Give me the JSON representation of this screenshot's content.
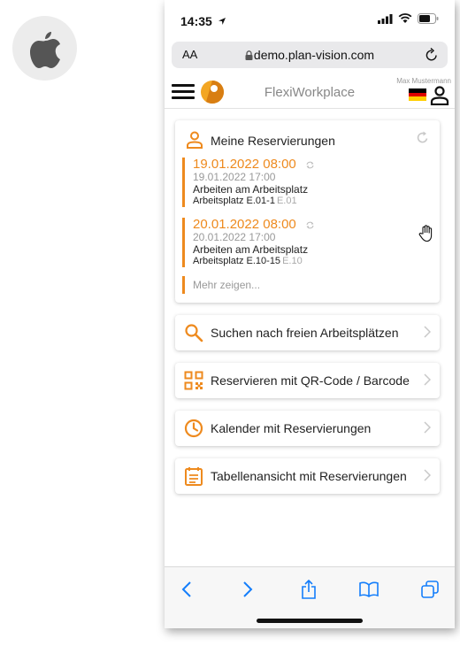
{
  "colors": {
    "accent": "#ee8a1e",
    "ios_blue": "#147efb"
  },
  "status_bar": {
    "time": "14:35"
  },
  "url_bar": {
    "aa_label": "AA",
    "url": "demo.plan-vision.com"
  },
  "app_header": {
    "title": "FlexiWorkplace",
    "user_name": "Max Mustermann"
  },
  "reservations": {
    "title": "Meine Reservierungen",
    "items": [
      {
        "start": "19.01.2022 08:00",
        "end": "19.01.2022 17:00",
        "description": "Arbeiten am Arbeitsplatz",
        "place": "Arbeitsplatz E.01-1",
        "floor": "E.01"
      },
      {
        "start": "20.01.2022 08:00",
        "end": "20.01.2022 17:00",
        "description": "Arbeiten am Arbeitsplatz",
        "place": "Arbeitsplatz E.10-15",
        "floor": "E.10"
      }
    ],
    "more_label": "Mehr zeigen..."
  },
  "actions": [
    {
      "label": "Suchen nach freien Arbeitsplätzen",
      "icon": "search-icon"
    },
    {
      "label": "Reservieren mit QR-Code / Barcode",
      "icon": "qr-code-icon"
    },
    {
      "label": "Kalender mit Reservierungen",
      "icon": "clock-icon"
    },
    {
      "label": "Tabellenansicht mit Reservierungen",
      "icon": "table-list-icon"
    }
  ],
  "toolbar": [
    "back-icon",
    "forward-icon",
    "share-icon",
    "bookmarks-icon",
    "tabs-icon"
  ]
}
